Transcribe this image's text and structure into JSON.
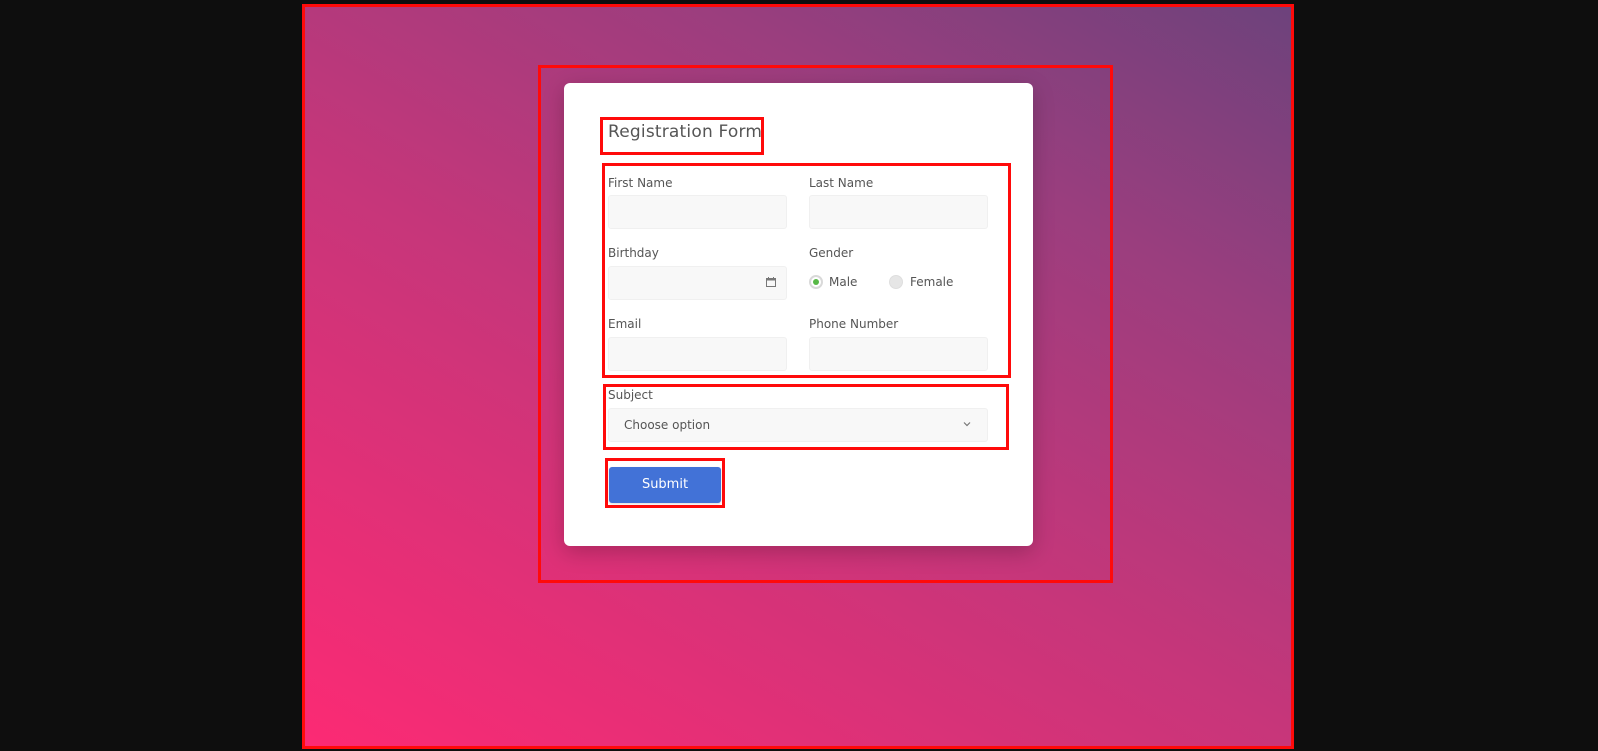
{
  "form": {
    "title": "Registration Form",
    "first_name_label": "First Name",
    "last_name_label": "Last Name",
    "birthday_label": "Birthday",
    "gender_label": "Gender",
    "gender_options": [
      "Male",
      "Female"
    ],
    "gender_selected": "Male",
    "email_label": "Email",
    "phone_label": "Phone Number",
    "subject_label": "Subject",
    "subject_value": "Choose option",
    "submit_label": "Submit",
    "values": {
      "first_name": "",
      "last_name": "",
      "birthday": "",
      "email": "",
      "phone": ""
    }
  },
  "icons": {
    "birthday": "calendar-icon",
    "subject": "chevron-down-icon"
  },
  "colors": {
    "accent": "#4272d7",
    "radio_checked": "#57b846",
    "highlight_box": "#ff0a0a",
    "background_start": "#fc2a74",
    "background_end": "#6d427c"
  }
}
